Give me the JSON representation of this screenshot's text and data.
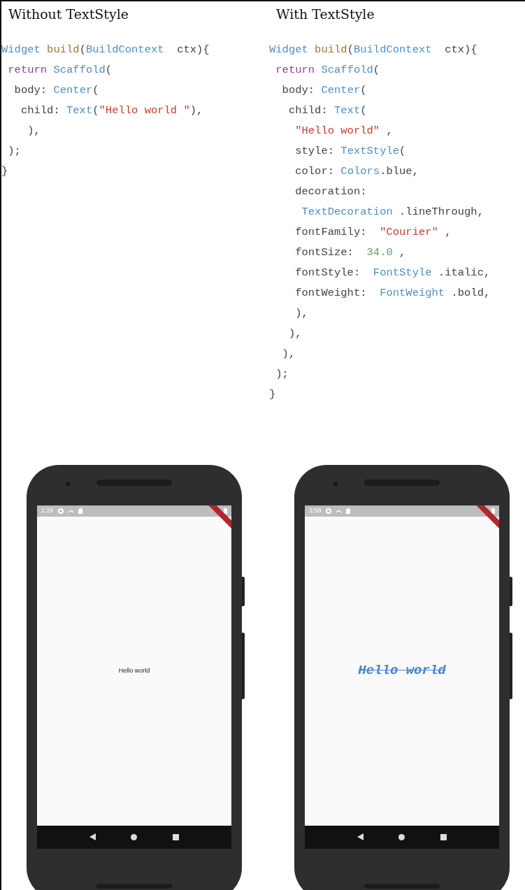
{
  "columns": [
    {
      "title": "Without TextStyle",
      "code": [
        [
          {
            "kind": "type",
            "text": "Widget"
          },
          {
            "kind": "fn",
            "text": " build"
          },
          {
            "kind": "plain",
            "text": "("
          },
          {
            "kind": "type",
            "text": "BuildContext"
          },
          {
            "kind": "plain",
            "text": "  ctx){"
          }
        ],
        [
          {
            "kind": "kw",
            "text": " return"
          },
          {
            "kind": "type",
            "text": " Scaffold"
          },
          {
            "kind": "plain",
            "text": "("
          }
        ],
        [
          {
            "kind": "plain",
            "text": "  body: "
          },
          {
            "kind": "type",
            "text": "Center"
          },
          {
            "kind": "plain",
            "text": "("
          }
        ],
        [
          {
            "kind": "plain",
            "text": "   child: "
          },
          {
            "kind": "type",
            "text": "Text"
          },
          {
            "kind": "plain",
            "text": "("
          },
          {
            "kind": "str",
            "text": "\"Hello world \""
          },
          {
            "kind": "plain",
            "text": "),"
          }
        ],
        [
          {
            "kind": "plain",
            "text": "    ),"
          }
        ],
        [
          {
            "kind": "plain",
            "text": " );"
          }
        ],
        [
          {
            "kind": "plain",
            "text": "}"
          }
        ]
      ],
      "phone": {
        "status_time": "1:29",
        "content_text": "Hello world",
        "kind": "plain"
      }
    },
    {
      "title": "With TextStyle",
      "code": [
        [
          {
            "kind": "type",
            "text": "Widget"
          },
          {
            "kind": "fn",
            "text": " build"
          },
          {
            "kind": "plain",
            "text": "("
          },
          {
            "kind": "type",
            "text": "BuildContext"
          },
          {
            "kind": "plain",
            "text": "  ctx){"
          }
        ],
        [
          {
            "kind": "kw",
            "text": " return"
          },
          {
            "kind": "type",
            "text": " Scaffold"
          },
          {
            "kind": "plain",
            "text": "("
          }
        ],
        [
          {
            "kind": "plain",
            "text": "  body: "
          },
          {
            "kind": "type",
            "text": "Center"
          },
          {
            "kind": "plain",
            "text": "("
          }
        ],
        [
          {
            "kind": "plain",
            "text": "   child: "
          },
          {
            "kind": "type",
            "text": "Text"
          },
          {
            "kind": "plain",
            "text": "("
          }
        ],
        [
          {
            "kind": "str",
            "text": "    \"Hello world\""
          },
          {
            "kind": "plain",
            "text": " ,"
          }
        ],
        [
          {
            "kind": "plain",
            "text": "    style: "
          },
          {
            "kind": "type",
            "text": "TextStyle"
          },
          {
            "kind": "plain",
            "text": "("
          }
        ],
        [
          {
            "kind": "plain",
            "text": "    color: "
          },
          {
            "kind": "type",
            "text": "Colors"
          },
          {
            "kind": "plain",
            "text": ".blue,"
          }
        ],
        [
          {
            "kind": "plain",
            "text": "    decoration:"
          }
        ],
        [
          {
            "kind": "type",
            "text": "     TextDecoration"
          },
          {
            "kind": "plain",
            "text": " .lineThrough,"
          }
        ],
        [
          {
            "kind": "plain",
            "text": "    fontFamily:  "
          },
          {
            "kind": "str",
            "text": "\"Courier\""
          },
          {
            "kind": "plain",
            "text": " ,"
          }
        ],
        [
          {
            "kind": "plain",
            "text": "    fontSize:  "
          },
          {
            "kind": "num",
            "text": "34.0"
          },
          {
            "kind": "plain",
            "text": " ,"
          }
        ],
        [
          {
            "kind": "plain",
            "text": "    fontStyle:  "
          },
          {
            "kind": "type",
            "text": "FontStyle"
          },
          {
            "kind": "plain",
            "text": " .italic,"
          }
        ],
        [
          {
            "kind": "plain",
            "text": "    fontWeight:  "
          },
          {
            "kind": "type",
            "text": "FontWeight"
          },
          {
            "kind": "plain",
            "text": " .bold,"
          }
        ],
        [
          {
            "kind": "plain",
            "text": "    ),"
          }
        ],
        [
          {
            "kind": "plain",
            "text": "   ),"
          }
        ],
        [
          {
            "kind": "plain",
            "text": "  ),"
          }
        ],
        [
          {
            "kind": "plain",
            "text": " );"
          }
        ],
        [
          {
            "kind": "plain",
            "text": "}"
          }
        ]
      ],
      "phone": {
        "status_time": "3:58",
        "content_text": "Hello world",
        "kind": "styled"
      }
    }
  ]
}
